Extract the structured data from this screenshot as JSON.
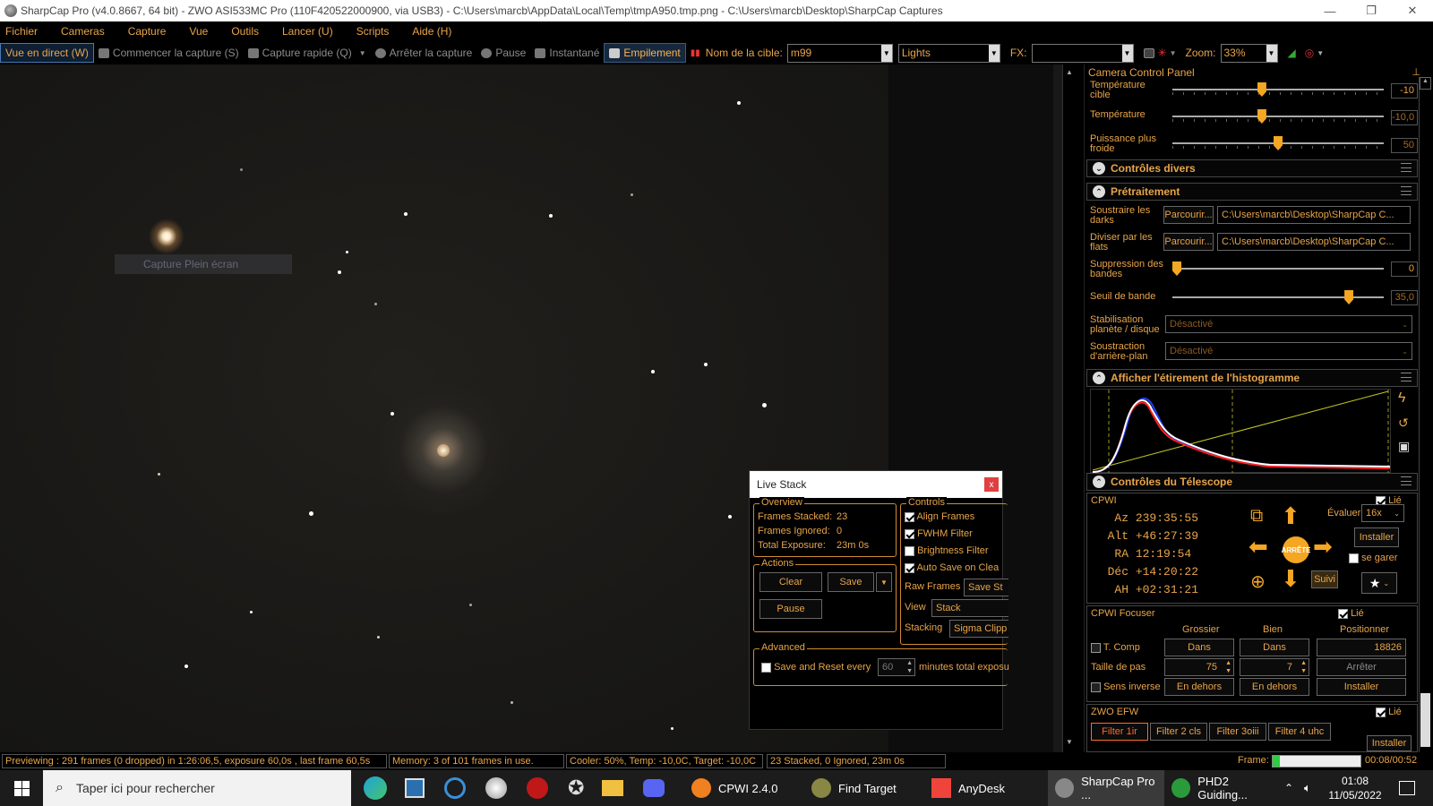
{
  "window": {
    "title": "SharpCap Pro (v4.0.8667, 64 bit) - ZWO ASI533MC Pro (110F420522000900, via USB3) - C:\\Users\\marcb\\AppData\\Local\\Temp\\tmpA950.tmp.png - C:\\Users\\marcb\\Desktop\\SharpCap Captures",
    "minimize": "—",
    "maximize": "❐",
    "close": "✕"
  },
  "menu": [
    "Fichier",
    "Cameras",
    "Capture",
    "Vue",
    "Outils",
    "Lancer (U)",
    "Scripts",
    "Aide (H)"
  ],
  "toolbar": {
    "live_view": "Vue en direct (W)",
    "start_capture": "Commencer la capture (S)",
    "quick_capture": "Capture rapide (Q)",
    "stop_capture": "Arrêter la capture",
    "pause": "Pause",
    "snapshot": "Instantané",
    "stacking": "Empilement",
    "target_label": "Nom de la cible:",
    "target_value": "m99",
    "frame_type": "Lights",
    "fx_label": "FX:",
    "fx_value": "",
    "zoom_label": "Zoom:",
    "zoom_value": "33%"
  },
  "image": {
    "capture_fullscreen": "Capture Plein écran"
  },
  "camera_panel": {
    "title": "Camera Control Panel",
    "target_temp": {
      "label": "Température cible",
      "value": "-10",
      "level": 0.42
    },
    "temperature": {
      "label": "Température",
      "value": "-10,0",
      "level": 0.42
    },
    "cooler_power": {
      "label": "Puissance plus froide",
      "value": "50",
      "level": 0.5
    },
    "misc_controls": "Contrôles divers",
    "preprocessing": {
      "title": "Prétraitement",
      "subtract_darks": "Soustraire les darks",
      "divide_flats": "Diviser par les flats",
      "browse": "Parcourir...",
      "darks_path": "C:\\Users\\marcb\\Desktop\\SharpCap C...",
      "flats_path": "C:\\Users\\marcb\\Desktop\\SharpCap C...",
      "banding_suppression": "Suppression des bandes",
      "banding_value": "0",
      "banding_level": 0,
      "banding_threshold": "Seuil de bande",
      "threshold_value": "35,0",
      "threshold_level": 0.85,
      "stabilization": "Stabilisation planète / disque",
      "stabilization_value": "Désactivé",
      "background_subtraction": "Soustraction d'arrière-plan",
      "background_value": "Désactivé"
    },
    "histogram": {
      "title": "Afficher l'étirement de l'histogramme"
    },
    "telescope": {
      "title": "Contrôles du Télescope",
      "mount": "CPWI",
      "linked": "Lié",
      "az_label": "Az",
      "az": "239:35:55",
      "alt_label": "Alt",
      "alt": "+46:27:39",
      "ra_label": "RA",
      "ra": "12:19:54",
      "dec_label": "Déc",
      "dec": "+14:20:22",
      "ha_label": "AH",
      "ha": "+02:31:21",
      "rate_label": "Évaluer:",
      "rate": "16x",
      "setup": "Installer",
      "park": "se garer",
      "stop": "ARRÊTE",
      "tracking": "Suivi"
    },
    "focuser": {
      "title": "CPWI Focuser",
      "linked": "Lié",
      "coarse": "Grossier",
      "fine": "Bien",
      "position": "Positionner",
      "temp_comp": "T. Comp",
      "in": "Dans",
      "position_value": "18826",
      "step_size": "Taille de pas",
      "coarse_step": "75",
      "fine_step": "7",
      "stop": "Arrêter",
      "reverse": "Sens inverse",
      "out": "En dehors",
      "setup": "Installer"
    },
    "efw": {
      "title": "ZWO EFW",
      "linked": "Lié",
      "filters": [
        "Filter 1ir",
        "Filter 2 cls",
        "Filter 3oiii",
        "Filter 4 uhc"
      ],
      "setup": "Installer"
    }
  },
  "live_stack": {
    "title": "Live Stack",
    "close": "x",
    "overview": "Overview",
    "frames_stacked_label": "Frames Stacked:",
    "frames_stacked": "23",
    "frames_ignored_label": "Frames Ignored:",
    "frames_ignored": "0",
    "total_exposure_label": "Total Exposure:",
    "total_exposure": "23m 0s",
    "actions": "Actions",
    "clear": "Clear",
    "save": "Save",
    "pause": "Pause",
    "controls": "Controls",
    "align_frames": "Align Frames",
    "fwhm_filter": "FWHM Filter",
    "brightness_filter": "Brightness Filter",
    "auto_save": "Auto Save on Clea",
    "raw_frames": "Raw Frames",
    "raw_frames_value": "Save St",
    "view": "View",
    "view_value": "Stack",
    "stacking": "Stacking",
    "stacking_value": "Sigma Clipp",
    "advanced": "Advanced",
    "save_reset": "Save and Reset every",
    "minutes_value": "60",
    "minutes_suffix": "minutes total exposu"
  },
  "status": {
    "preview": "Previewing : 291 frames (0 dropped) in 1:26:06,5, exposure 60,0s , last frame 60,5s",
    "memory": "Memory: 3 of 101 frames in use.",
    "cooler": "Cooler: 50%, Temp: -10,0C, Target: -10,0C",
    "stacked": "23 Stacked, 0 Ignored, 23m 0s",
    "frame_label": "Frame:",
    "frame_progress": 0.08,
    "frame_time": "00:08/00:52"
  },
  "taskbar": {
    "search_placeholder": "Taper ici pour rechercher",
    "apps": [
      "CPWI 2.4.0",
      "Find Target",
      "AnyDesk",
      "SharpCap Pro ...",
      "PHD2 Guiding..."
    ],
    "time": "01:08",
    "date": "11/05/2022"
  },
  "colors": {
    "accent": "#e8a44a",
    "slider": "#f5a623",
    "arrow": "#f5a623"
  }
}
